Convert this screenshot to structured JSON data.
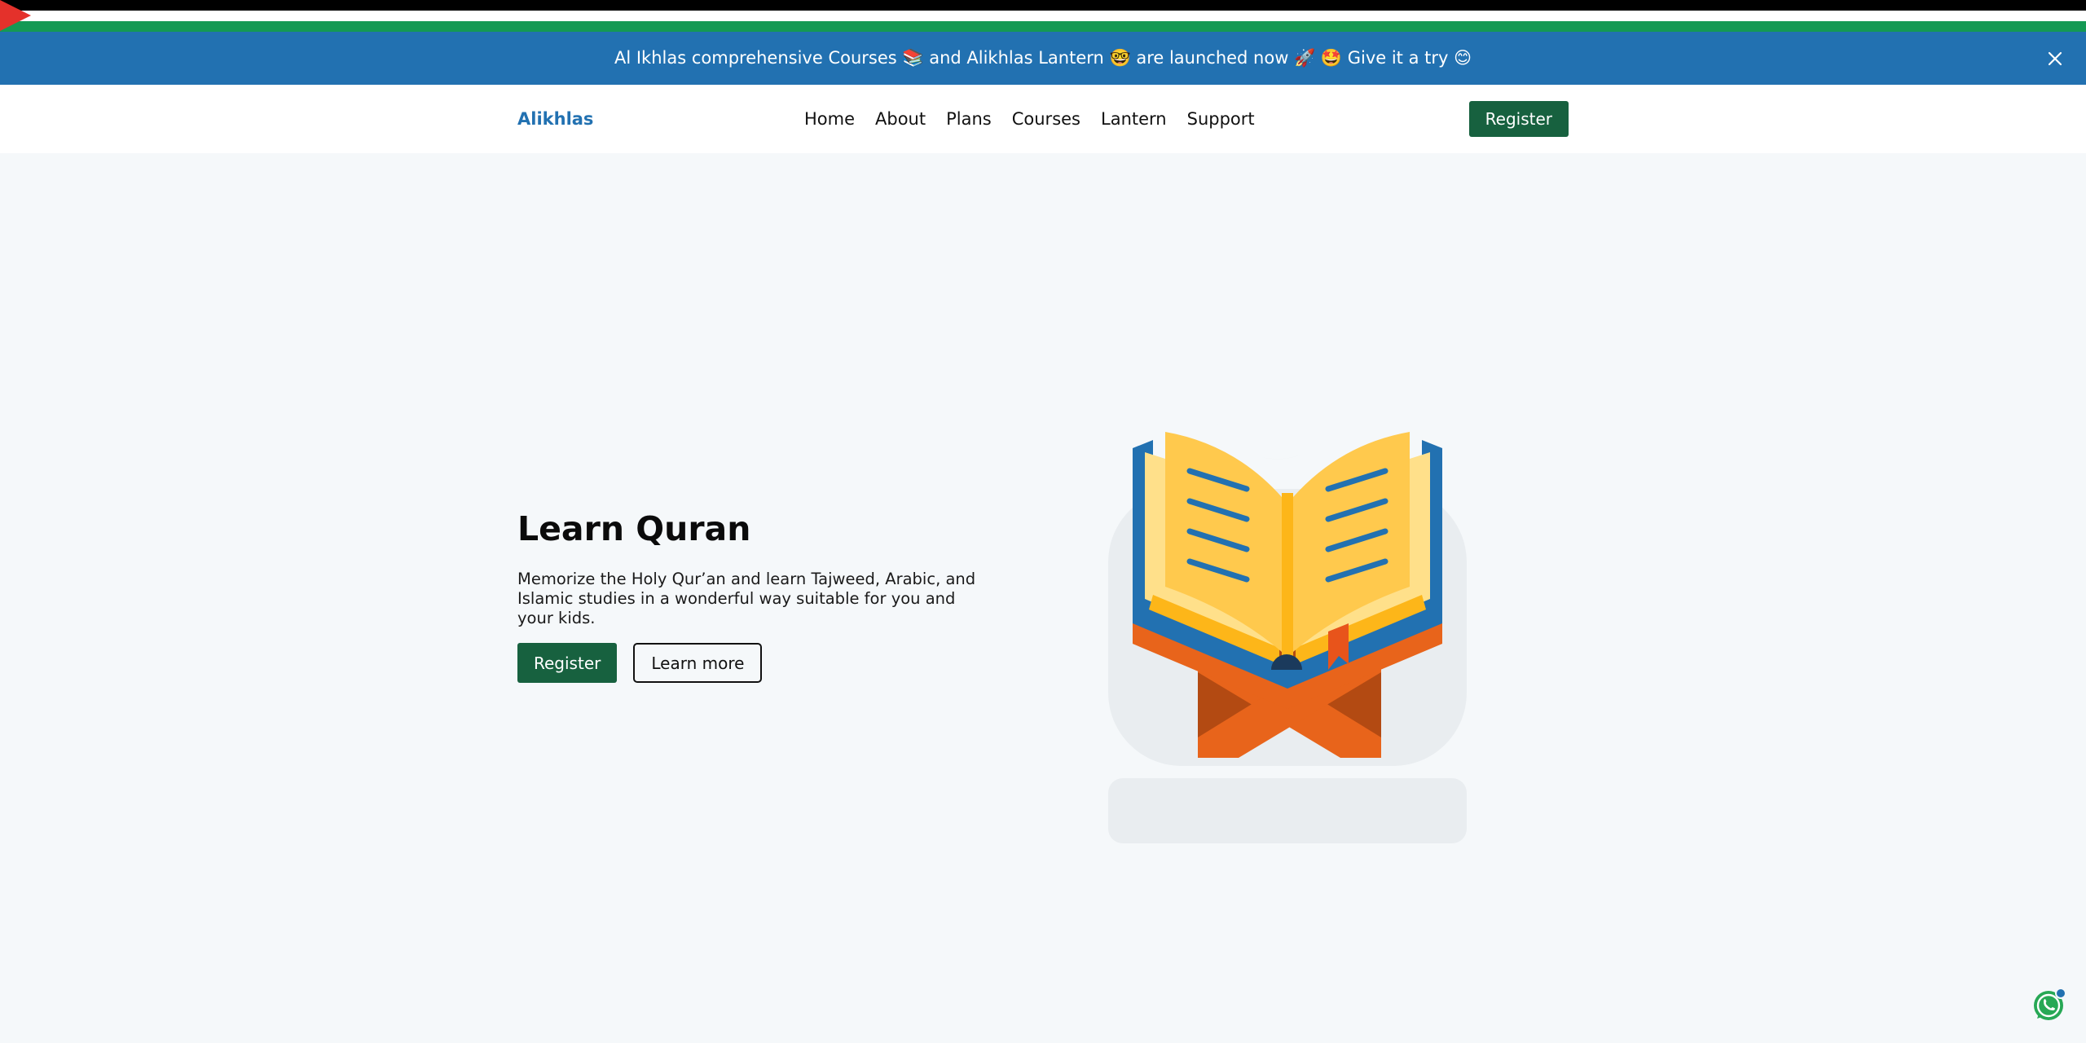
{
  "announcement": {
    "text": "Al Ikhlas comprehensive Courses 📚 and Alikhlas Lantern 🤓 are launched now 🚀 🤩 Give it a try 😊"
  },
  "navbar": {
    "brand": "Alikhlas",
    "links": [
      "Home",
      "About",
      "Plans",
      "Courses",
      "Lantern",
      "Support"
    ],
    "register_label": "Register"
  },
  "hero": {
    "title": "Learn Quran",
    "description": "Memorize the Holy Qur’an and learn Tajweed, Arabic, and Islamic studies in a wonderful way suitable for you and your kids.",
    "register_label": "Register",
    "learn_more_label": "Learn more"
  },
  "colors": {
    "primary_blue": "#2271b1",
    "primary_green": "#17613f",
    "background": "#f5f8fa"
  },
  "icons": {
    "close": "close-icon",
    "whatsapp": "whatsapp-icon",
    "illustration": "quran-book-icon"
  }
}
